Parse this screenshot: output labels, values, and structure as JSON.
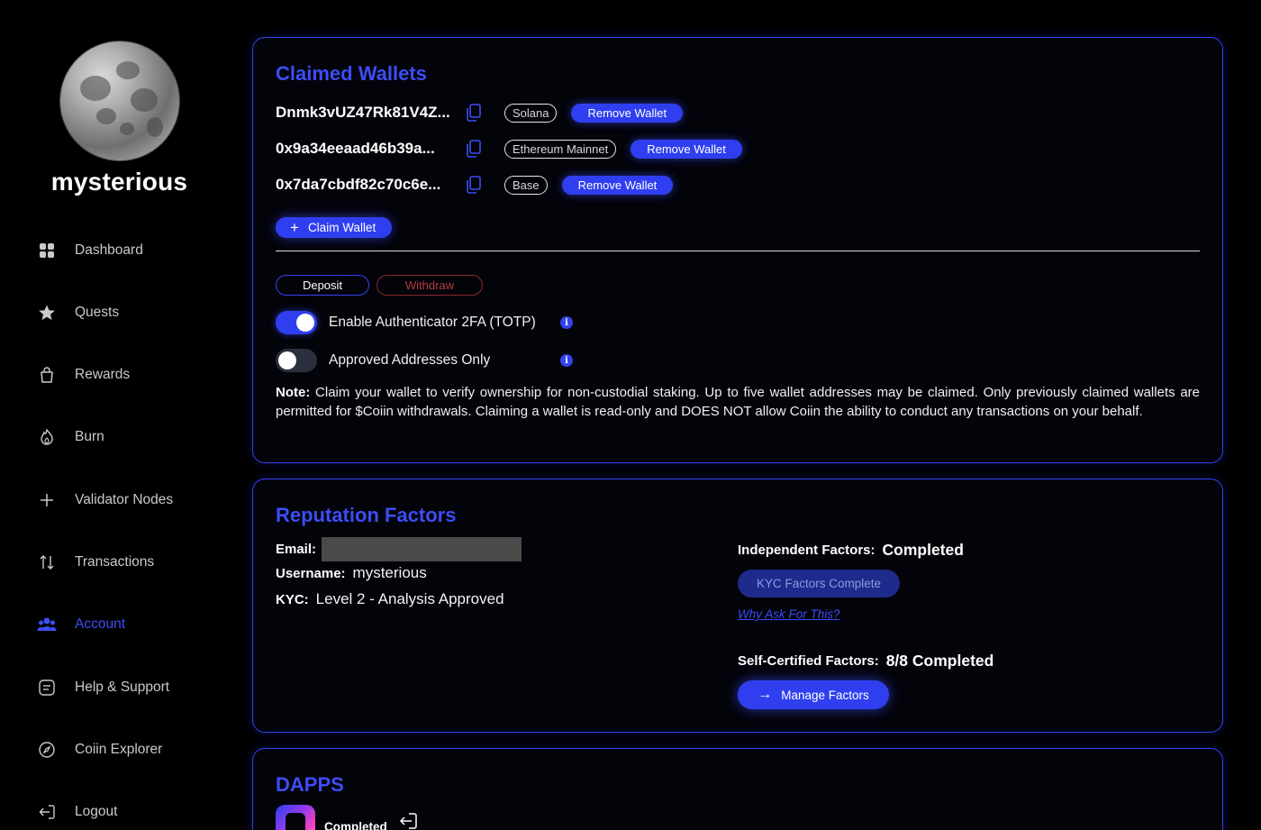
{
  "profile": {
    "username": "mysterious"
  },
  "sidebar": {
    "items": [
      {
        "label": "Dashboard",
        "icon": "grid-icon"
      },
      {
        "label": "Quests",
        "icon": "star-icon"
      },
      {
        "label": "Rewards",
        "icon": "bag-icon"
      },
      {
        "label": "Burn",
        "icon": "flame-icon"
      },
      {
        "label": "Validator Nodes",
        "icon": "plus-icon"
      },
      {
        "label": "Transactions",
        "icon": "arrows-updown-icon"
      },
      {
        "label": "Account",
        "icon": "users-icon",
        "active": true
      },
      {
        "label": "Help & Support",
        "icon": "document-icon"
      },
      {
        "label": "Coiin Explorer",
        "icon": "compass-icon"
      },
      {
        "label": "Logout",
        "icon": "logout-icon"
      }
    ]
  },
  "claimed_wallets": {
    "title": "Claimed Wallets",
    "wallets": [
      {
        "address": "Dnmk3vUZ47Rk81V4Z...",
        "chain": "Solana",
        "action": "Remove Wallet"
      },
      {
        "address": "0x9a34eeaad46b39a...",
        "chain": "Ethereum Mainnet",
        "action": "Remove Wallet"
      },
      {
        "address": "0x7da7cbdf82c70c6e...",
        "chain": "Base",
        "action": "Remove Wallet"
      }
    ],
    "claim_label": "Claim Wallet",
    "tabs": {
      "deposit": "Deposit",
      "withdraw": "Withdraw"
    },
    "toggles": [
      {
        "label": "Enable Authenticator 2FA (TOTP)",
        "on": true
      },
      {
        "label": "Approved Addresses Only",
        "on": false
      }
    ],
    "note_label": "Note:",
    "note_text": "Claim your wallet to verify ownership for non-custodial staking. Up to five wallet addresses may be claimed. Only previously claimed wallets are permitted for $Coiin withdrawals. Claiming a wallet is read-only and DOES NOT allow Coiin the ability to conduct any transactions on your behalf."
  },
  "reputation": {
    "title": "Reputation Factors",
    "email_label": "Email:",
    "username_label": "Username:",
    "username_value": "mysterious",
    "kyc_label": "KYC:",
    "kyc_value": "Level 2 - Analysis Approved",
    "independent_label": "Independent Factors:",
    "independent_value": "Completed",
    "kyc_button": "KYC Factors Complete",
    "why_link": "Why Ask For This?",
    "self_certified_label": "Self-Certified Factors:",
    "self_certified_value": "8/8 Completed",
    "manage_button": "Manage Factors"
  },
  "dapps": {
    "title": "DAPPS",
    "status": "Completed"
  },
  "colors": {
    "accent": "#3d4df5",
    "button": "#2f3ff0",
    "withdraw": "#b33c3c",
    "background": "#000000"
  }
}
